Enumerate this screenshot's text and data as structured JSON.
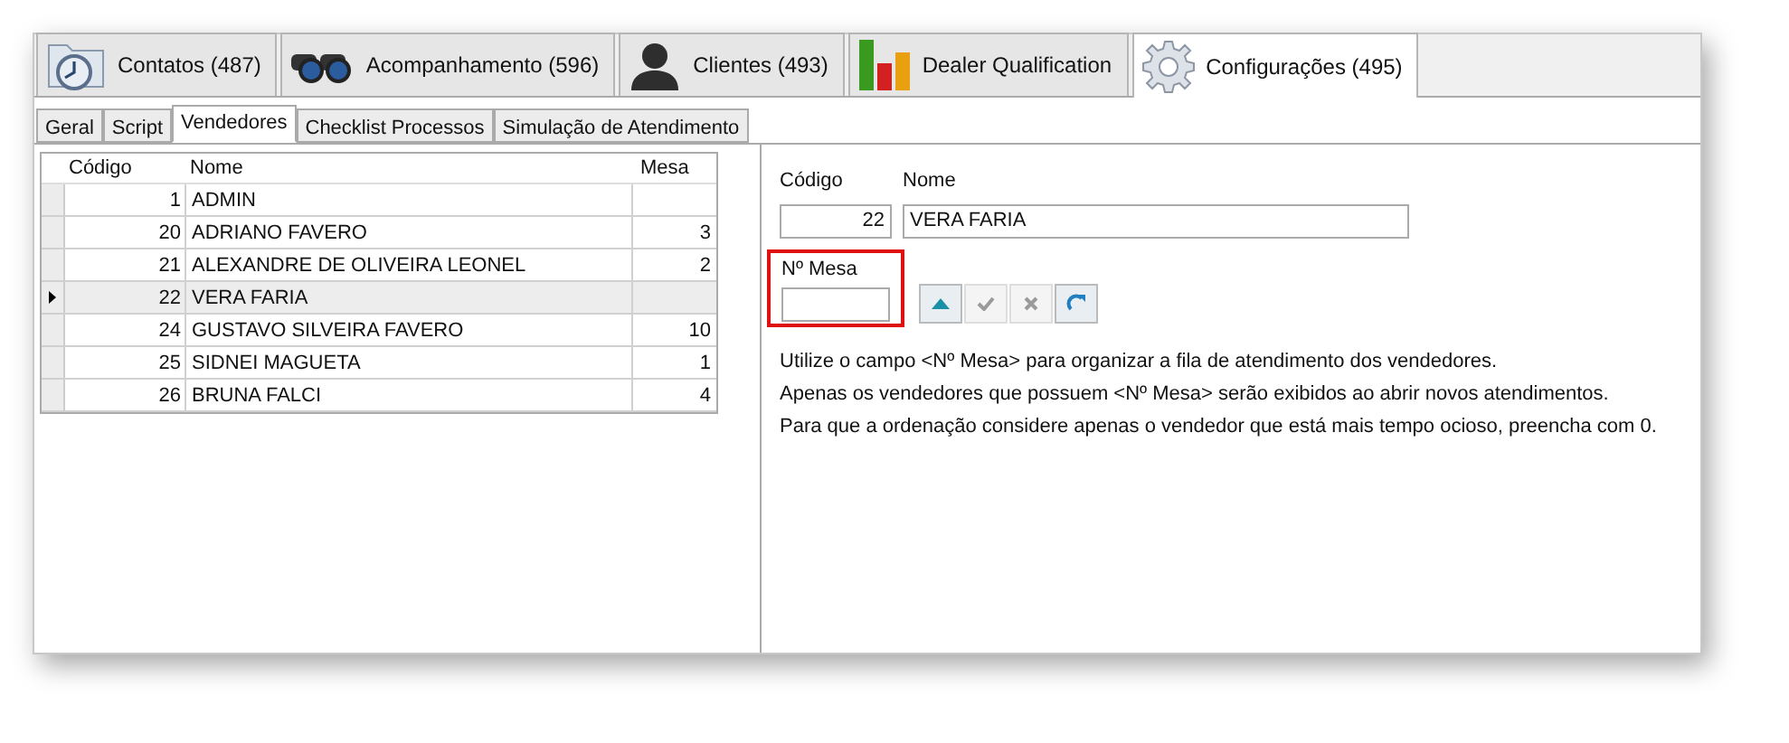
{
  "main_tabs": [
    {
      "label": "Contatos (487)",
      "kind": "folder-clock",
      "selected": false
    },
    {
      "label": "Acompanhamento (596)",
      "kind": "binoculars",
      "selected": false
    },
    {
      "label": "Clientes (493)",
      "kind": "person",
      "selected": false
    },
    {
      "label": "Dealer Qualification",
      "kind": "bars",
      "selected": false
    },
    {
      "label": "Configurações (495)",
      "kind": "gear",
      "selected": true
    }
  ],
  "sub_tabs": [
    {
      "label": "Geral",
      "selected": false
    },
    {
      "label": "Script",
      "selected": false
    },
    {
      "label": "Vendedores",
      "selected": true
    },
    {
      "label": "Checklist Processos",
      "selected": false
    },
    {
      "label": "Simulação de Atendimento",
      "selected": false
    }
  ],
  "table": {
    "columns": [
      "Código",
      "Nome",
      "Mesa"
    ],
    "rows": [
      {
        "codigo": "1",
        "nome": "ADMIN",
        "selected": false
      },
      {
        "codigo": "20",
        "nome": "ADRIANO FAVERO",
        "mesa": "3",
        "selected": false
      },
      {
        "codigo": "21",
        "nome": "ALEXANDRE DE OLIVEIRA LEONEL",
        "mesa": "2",
        "selected": false
      },
      {
        "codigo": "22",
        "nome": "VERA FARIA",
        "selected": true
      },
      {
        "codigo": "24",
        "nome": "GUSTAVO SILVEIRA FAVERO",
        "mesa": "10",
        "selected": false
      },
      {
        "codigo": "25",
        "nome": "SIDNEI MAGUETA",
        "mesa": "1",
        "selected": false
      },
      {
        "codigo": "26",
        "nome": "BRUNA FALCI",
        "mesa": "4",
        "selected": false
      }
    ]
  },
  "form": {
    "codigo": {
      "label": "Código",
      "value": "22"
    },
    "nome": {
      "label": "Nome",
      "value": "VERA FARIA"
    },
    "mesa": {
      "label": "Nº Mesa",
      "highlighted": true
    },
    "buttons": [
      {
        "kind": "up",
        "disabled": false
      },
      {
        "kind": "check",
        "disabled": true
      },
      {
        "kind": "cancel",
        "disabled": true
      },
      {
        "kind": "refresh",
        "disabled": false
      }
    ],
    "help": [
      "Utilize o campo <Nº Mesa> para organizar a fila de atendimento dos vendedores.",
      "Apenas os vendedores que possuem <Nº Mesa> serão exibidos ao abrir novos atendimentos.",
      "Para que a ordenação considere apenas o vendedor que está mais tempo ocioso, preencha com 0."
    ]
  }
}
